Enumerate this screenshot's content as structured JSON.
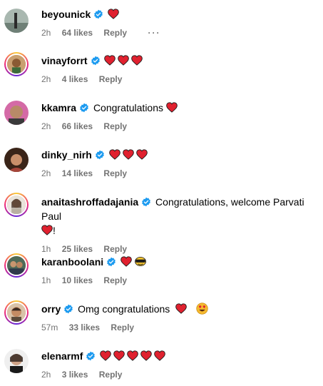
{
  "comments": [
    {
      "username": "beyounick",
      "text": "",
      "hearts": 1,
      "time": "2h",
      "likes": "64 likes",
      "reply": "Reply",
      "more": "···",
      "story": false,
      "avatar": "beyounick-avatar"
    },
    {
      "username": "vinayforrt",
      "text": "",
      "hearts": 3,
      "time": "2h",
      "likes": "4 likes",
      "reply": "Reply",
      "story": true,
      "avatar": "vinayforrt-avatar"
    },
    {
      "username": "kkamra",
      "text": "Congratulations",
      "hearts": 1,
      "time": "2h",
      "likes": "66 likes",
      "reply": "Reply",
      "story": false,
      "avatar": "kkamra-avatar"
    },
    {
      "username": "dinky_nirh",
      "text": "",
      "hearts": 3,
      "time": "2h",
      "likes": "14 likes",
      "reply": "Reply",
      "story": false,
      "avatar": "dinky-avatar"
    },
    {
      "username": "anaitashroffadajania",
      "text": "Congratulations, welcome Parvati Paul",
      "text2": "!",
      "hearts": 1,
      "time": "1h",
      "likes": "25 likes",
      "reply": "Reply",
      "story": true,
      "avatar": "anaita-avatar"
    },
    {
      "username": "karanboolani",
      "text": "",
      "hearts": 1,
      "time": "1h",
      "likes": "10 likes",
      "reply": "Reply",
      "story": true,
      "avatar": "karan-avatar"
    },
    {
      "username": "orry",
      "text": "Omg congratulations",
      "hearts": 1,
      "time": "57m",
      "likes": "33 likes",
      "reply": "Reply",
      "story": true,
      "avatar": "orry-avatar"
    },
    {
      "username": "elenarmf",
      "text": "",
      "hearts": 5,
      "time": "2h",
      "likes": "3 likes",
      "reply": "Reply",
      "story": false,
      "avatar": "elenarmf-avatar"
    }
  ],
  "colors": {
    "heart": "#e0212f",
    "verified": "#1d9bf0",
    "meta": "#737373"
  }
}
